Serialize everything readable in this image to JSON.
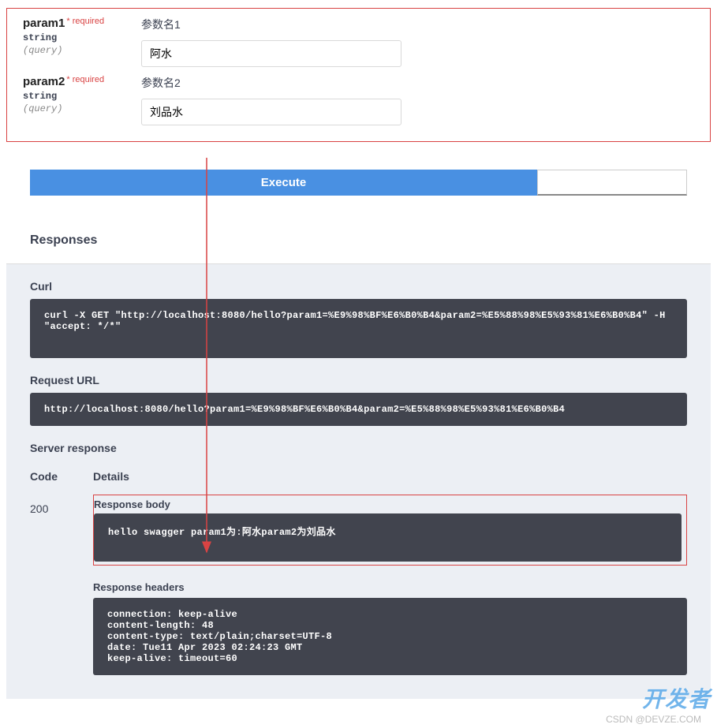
{
  "params": [
    {
      "name": "param1",
      "required_label": "* required",
      "type": "string",
      "loc": "(query)",
      "desc": "参数名1",
      "value": "阿水"
    },
    {
      "name": "param2",
      "required_label": "* required",
      "type": "string",
      "loc": "(query)",
      "desc": "参数名2",
      "value": "刘品水"
    }
  ],
  "buttons": {
    "execute": "Execute"
  },
  "responses_label": "Responses",
  "curl": {
    "label": "Curl",
    "cmd": "curl -X GET \"http://localhost:8080/hello?param1=%E9%98%BF%E6%B0%B4&param2=%E5%88%98%E5%93%81%E6%B0%B4\" -H \"accept: */*\""
  },
  "request_url": {
    "label": "Request URL",
    "value": "http://localhost:8080/hello?param1=%E9%98%BF%E6%B0%B4&param2=%E5%88%98%E5%93%81%E6%B0%B4"
  },
  "server_response_label": "Server response",
  "table_headers": {
    "code": "Code",
    "details": "Details"
  },
  "response": {
    "code": "200",
    "body_label": "Response body",
    "body": "hello swagger param1为:阿水param2为刘品水",
    "headers_label": "Response headers",
    "headers": "connection: keep-alive\ncontent-length: 48\ncontent-type: text/plain;charset=UTF-8\ndate: Tue11 Apr 2023 02:24:23 GMT\nkeep-alive: timeout=60"
  },
  "watermark": {
    "main": "开发者",
    "sub": "CSDN @DEVZE.COM"
  }
}
